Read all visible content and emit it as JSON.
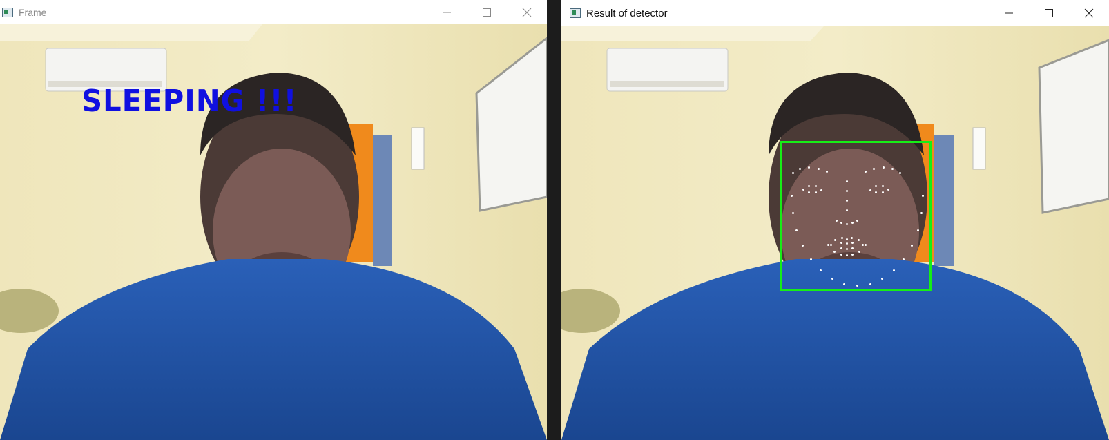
{
  "windows": {
    "frame": {
      "title": "Frame",
      "overlay_text": "SLEEPING !!!",
      "overlay_color": "#1010e0",
      "controls": [
        "minimize-icon",
        "maximize-icon",
        "close-icon"
      ]
    },
    "result": {
      "title": "Result of detector",
      "bbox_color": "#16ee16",
      "landmark_color": "#ffffff",
      "controls": [
        "minimize-icon",
        "maximize-icon",
        "close-icon"
      ]
    }
  }
}
